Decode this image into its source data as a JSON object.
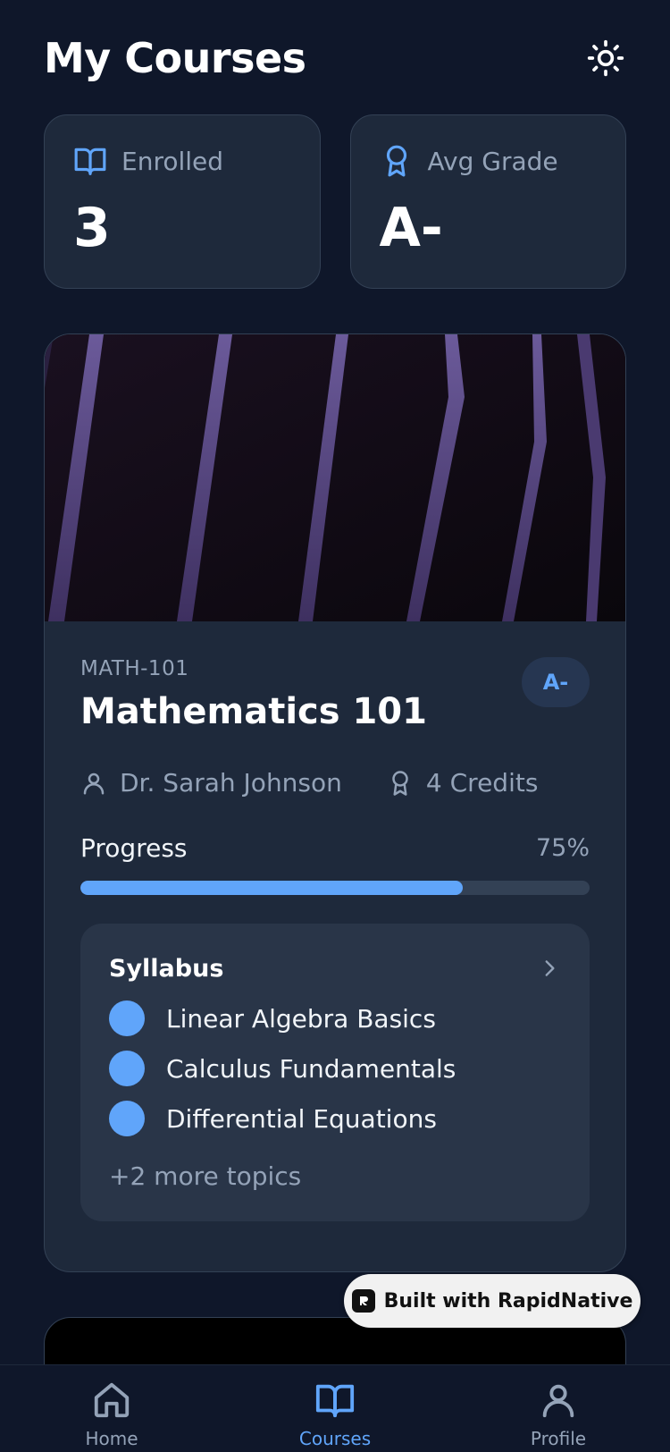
{
  "header": {
    "title": "My Courses",
    "theme_icon": "sun-icon"
  },
  "stats": [
    {
      "icon": "book-open-icon",
      "label": "Enrolled",
      "value": "3"
    },
    {
      "icon": "award-icon",
      "label": "Avg Grade",
      "value": "A-"
    }
  ],
  "course": {
    "code": "MATH-101",
    "name": "Mathematics 101",
    "grade": "A-",
    "instructor": "Dr. Sarah Johnson",
    "credits": "4 Credits",
    "progress_label": "Progress",
    "progress_text": "75%",
    "progress_fraction": 0.75,
    "syllabus": {
      "title": "Syllabus",
      "topics": [
        "Linear Algebra Basics",
        "Calculus Fundamentals",
        "Differential Equations"
      ],
      "more": "+2 more topics"
    }
  },
  "badge": {
    "text": "Built with RapidNative"
  },
  "tabs": [
    {
      "label": "Home",
      "icon": "home-icon",
      "active": false
    },
    {
      "label": "Courses",
      "icon": "book-open-icon",
      "active": true
    },
    {
      "label": "Profile",
      "icon": "user-icon",
      "active": false
    }
  ],
  "colors": {
    "background": "#0f172a",
    "card": "#1e293b",
    "accent": "#60a5fa",
    "muted": "#94a3b8"
  }
}
